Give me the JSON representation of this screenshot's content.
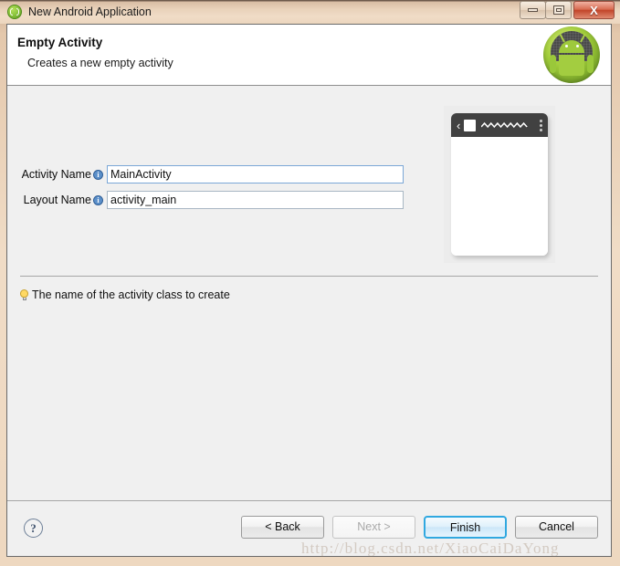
{
  "window": {
    "title": "New Android Application",
    "icon": "android-wizard-icon",
    "controls": {
      "minimize": "minimize-button",
      "maximize": "maximize-button",
      "close_glyph": "X"
    }
  },
  "header": {
    "title": "Empty Activity",
    "subtitle": "Creates a new empty activity",
    "badge_icon": "android-robot-icon"
  },
  "form": {
    "fields": [
      {
        "label": "Activity Name",
        "value": "MainActivity",
        "info_glyph": "i",
        "focused": true
      },
      {
        "label": "Layout Name",
        "value": "activity_main",
        "info_glyph": "i",
        "focused": false
      }
    ]
  },
  "preview": {
    "name": "activity-preview",
    "actionbar": {
      "back_glyph": "‹",
      "app_icon": "app-square-icon",
      "title_placeholder": "zigzag-title-placeholder",
      "overflow": "overflow-menu-icon"
    }
  },
  "hint": {
    "icon": "lightbulb-icon",
    "text": "The name of the activity class to create"
  },
  "footer": {
    "help_glyph": "?",
    "buttons": [
      {
        "label": "< Back",
        "state": "enabled"
      },
      {
        "label": "Next >",
        "state": "disabled"
      },
      {
        "label": "Finish",
        "state": "default"
      },
      {
        "label": "Cancel",
        "state": "enabled"
      }
    ]
  },
  "watermark": {
    "text": "http://blog.csdn.net/XiaoCaiDaYong"
  },
  "colors": {
    "window_chrome": "#ecd6be",
    "dialog_bg": "#f0f0f0",
    "header_bg": "#ffffff",
    "accent_default_button": "#30a8e0",
    "actionbar": "#414141",
    "android_green": "#a3cd40"
  }
}
